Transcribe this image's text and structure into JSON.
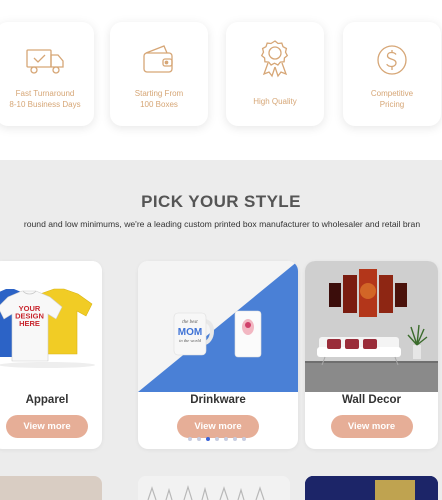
{
  "features": [
    {
      "name": "fast-turnaround",
      "icon": "truck-icon",
      "line1": "Fast Turnaround",
      "line2": "8-10 Business Days"
    },
    {
      "name": "starting-from",
      "icon": "wallet-icon",
      "line1": "Starting From",
      "line2": "100 Boxes"
    },
    {
      "name": "high-quality",
      "icon": "award-ribbon-icon",
      "line1": "High Quality",
      "line2": ""
    },
    {
      "name": "competitive-pricing",
      "icon": "dollar-coin-icon",
      "line1": "Competitive",
      "line2": "Pricing"
    }
  ],
  "style_section": {
    "title": "PICK YOUR STYLE",
    "subtitle": "round and low minimums, we're a leading custom printed box manufacturer to wholesaler and retail bran"
  },
  "products": [
    {
      "name": "Apparel",
      "button": "View more"
    },
    {
      "name": "Drinkware",
      "button": "View more"
    },
    {
      "name": "Wall Decor",
      "button": "View more"
    }
  ],
  "apparel_shirt_text": "YOUR DESIGN HERE",
  "mug_text": "MOM",
  "carousel": {
    "count": 7,
    "active": 2
  },
  "colors": {
    "accent": "#e6ae97",
    "icon": "#d6a676",
    "section_bg": "#ececec",
    "dot_active": "#3a63d8"
  }
}
